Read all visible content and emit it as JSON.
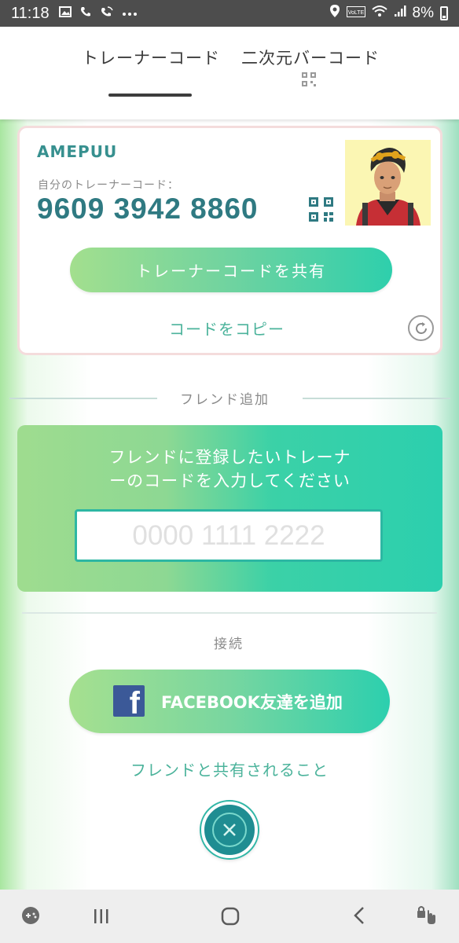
{
  "status_bar": {
    "time": "11:18",
    "battery": "8%",
    "icons": [
      "image-icon",
      "call-icon",
      "wifi-call-icon",
      "more-dots-icon",
      "location-icon",
      "volte-icon",
      "wifi-icon",
      "signal-icon",
      "battery-icon"
    ]
  },
  "tabs": {
    "trainer_code": "トレーナーコード",
    "qr_code": "二次元バーコード"
  },
  "card": {
    "name": "AMEPUU",
    "code_label": "自分のトレーナーコード：",
    "code": "9609 3942 8860",
    "share_button": "トレーナーコードを共有",
    "copy_link": "コードをコピー"
  },
  "friend_add": {
    "section_label": "フレンド追加",
    "instruction_line1": "フレンドに登録したいトレーナ",
    "instruction_line2": "ーのコードを入力してください",
    "input_placeholder": "0000 1111 2222"
  },
  "connect": {
    "section_label": "接続",
    "facebook_button": "FACEBOOK友達を追加",
    "shared_info_link": "フレンドと共有されること"
  },
  "colors": {
    "accent_teal": "#2ccfae",
    "accent_green": "#a3df8e",
    "code_text": "#2f7a82",
    "link": "#4bb39b",
    "facebook": "#3b5998"
  }
}
